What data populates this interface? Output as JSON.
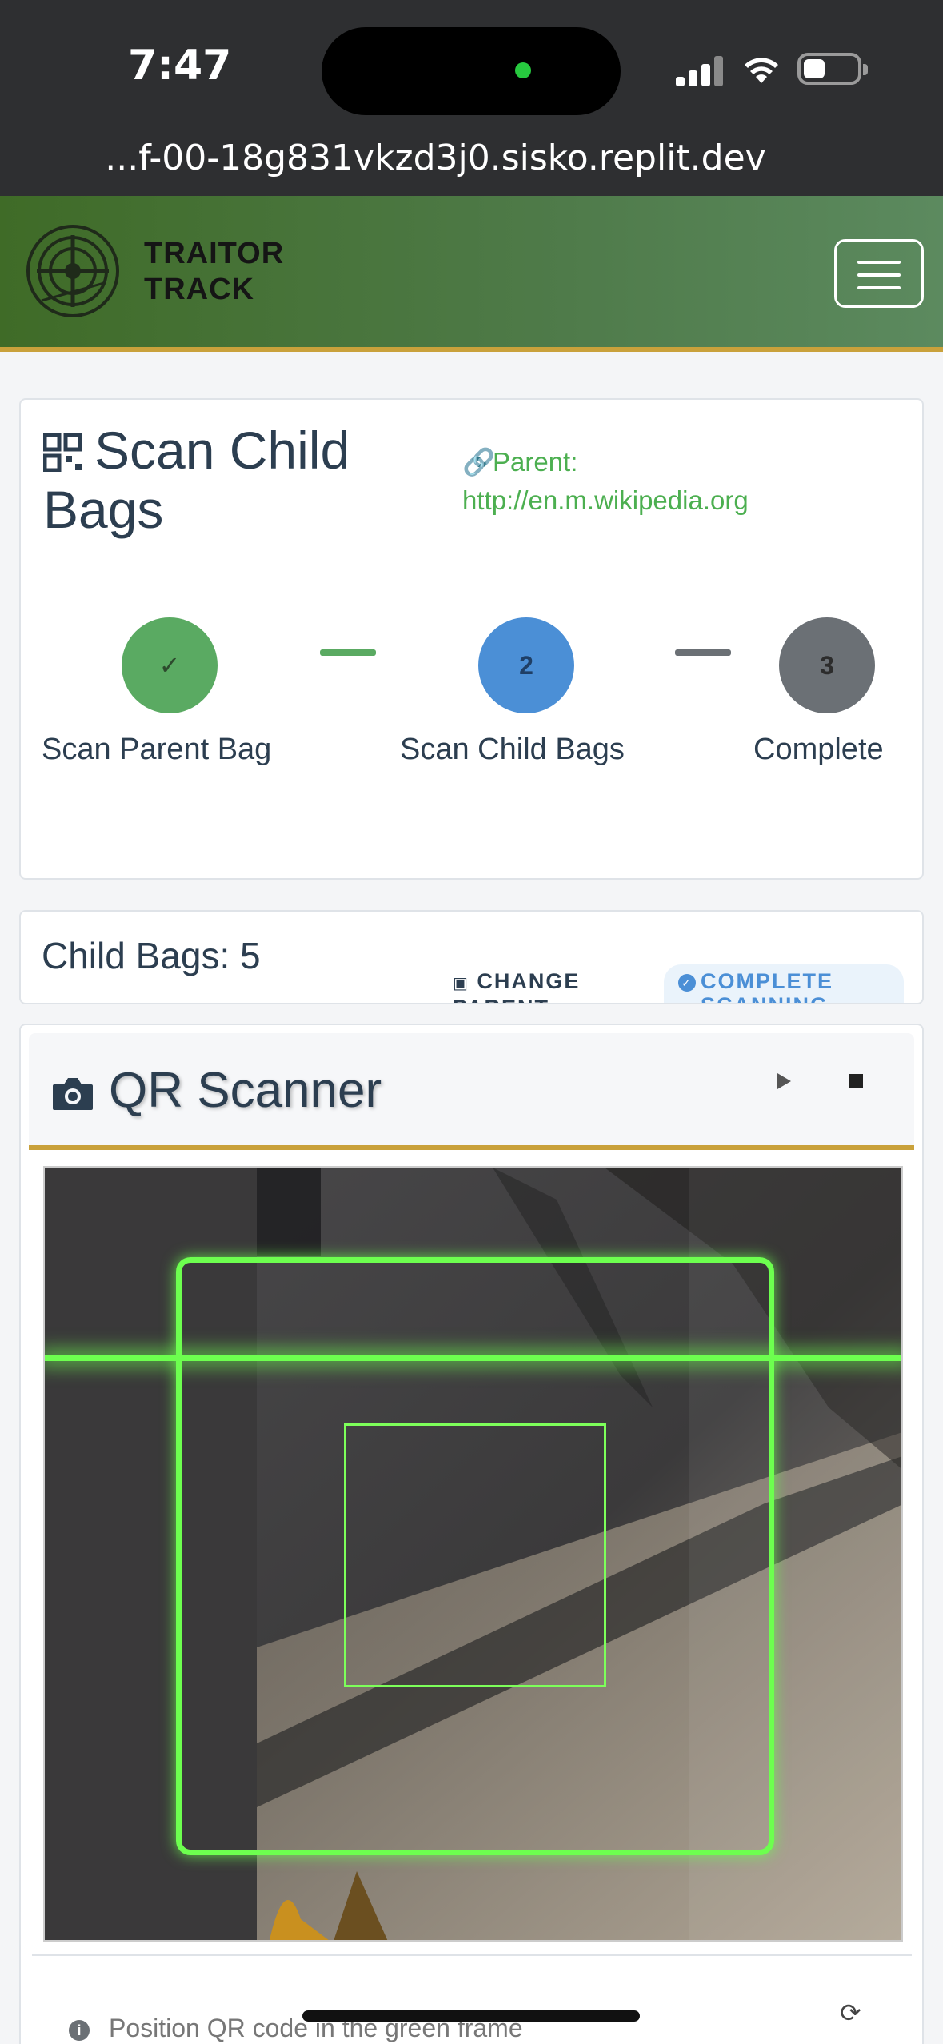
{
  "status": {
    "time": "7:47",
    "url": "...f-00-18g831vkzd3j0.sisko.replit.dev"
  },
  "nav": {
    "brand_line1": "TRAITOR",
    "brand_line2": "TRACK"
  },
  "scan": {
    "title": "Scan Child Bags",
    "parent_label": "Parent:",
    "parent_value": "http://en.m.wikipedia.org",
    "steps": [
      {
        "marker": "✓",
        "label": "Scan Parent Bag",
        "state": "done"
      },
      {
        "marker": "2",
        "label": "Scan Child Bags",
        "state": "active"
      },
      {
        "marker": "3",
        "label": "Complete",
        "state": "pending"
      }
    ]
  },
  "bags": {
    "count_text": "Child Bags: 5",
    "change_label": "CHANGE PARENT",
    "complete_label": "COMPLETE SCANNING"
  },
  "scanner": {
    "title": "QR Scanner",
    "hint": "Position QR code in the green frame"
  },
  "colors": {
    "accent_green": "#4caf50",
    "step_blue": "#4b8fd6",
    "frame_green": "#6dff4f",
    "gold": "#c9a13b"
  }
}
